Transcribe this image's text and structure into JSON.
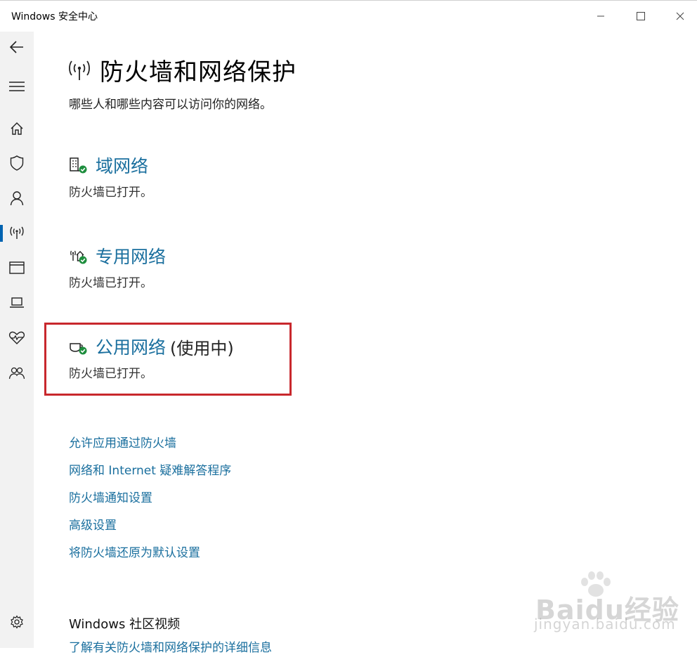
{
  "window": {
    "title": "Windows 安全中心"
  },
  "sidebar": {
    "items": [
      {
        "icon": "back-arrow-icon"
      },
      {
        "icon": "hamburger-menu-icon"
      },
      {
        "icon": "home-icon"
      },
      {
        "icon": "shield-icon"
      },
      {
        "icon": "person-icon"
      },
      {
        "icon": "wireless-antenna-icon",
        "active": true
      },
      {
        "icon": "app-browser-icon"
      },
      {
        "icon": "laptop-icon"
      },
      {
        "icon": "heart-health-icon"
      },
      {
        "icon": "family-icon"
      },
      {
        "icon": "gear-icon"
      }
    ]
  },
  "page": {
    "title": "防火墙和网络保护",
    "subtitle": "哪些人和哪些内容可以访问你的网络。"
  },
  "networks": [
    {
      "name": "域网络",
      "status": "防火墙已打开。",
      "icon": "domain-network-icon",
      "in_use": ""
    },
    {
      "name": "专用网络",
      "status": "防火墙已打开。",
      "icon": "private-network-icon",
      "in_use": ""
    },
    {
      "name": "公用网络",
      "status": "防火墙已打开。",
      "icon": "public-network-icon",
      "in_use": "(使用中)"
    }
  ],
  "links": [
    "允许应用通过防火墙",
    "网络和 Internet 疑难解答程序",
    "防火墙通知设置",
    "高级设置",
    "将防火墙还原为默认设置"
  ],
  "community": {
    "title": "Windows 社区视频",
    "link": "了解有关防火墙和网络保护的详细信息"
  },
  "watermark": {
    "brand": "Baidu经验",
    "site": "jingyan.baidu.com"
  },
  "colors": {
    "link": "#1a6f9e",
    "accent": "#0063b1",
    "status_ok": "#1e8e3e",
    "highlight": "#c8282d"
  }
}
